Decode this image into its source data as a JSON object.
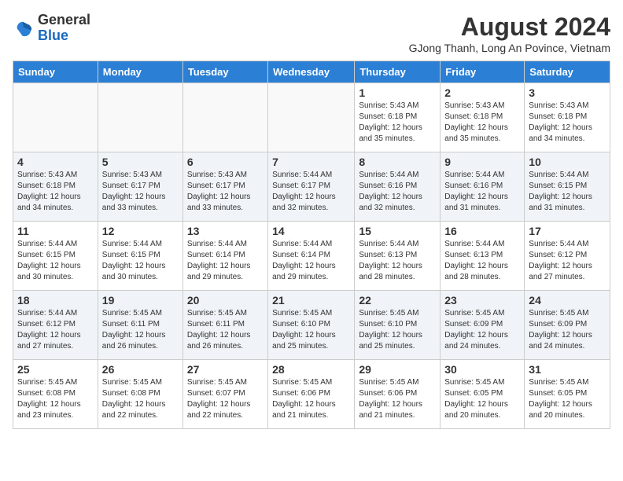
{
  "header": {
    "logo_general": "General",
    "logo_blue": "Blue",
    "month_year": "August 2024",
    "location": "GJong Thanh, Long An Povince, Vietnam"
  },
  "weekdays": [
    "Sunday",
    "Monday",
    "Tuesday",
    "Wednesday",
    "Thursday",
    "Friday",
    "Saturday"
  ],
  "weeks": [
    [
      {
        "day": "",
        "info": ""
      },
      {
        "day": "",
        "info": ""
      },
      {
        "day": "",
        "info": ""
      },
      {
        "day": "",
        "info": ""
      },
      {
        "day": "1",
        "info": "Sunrise: 5:43 AM\nSunset: 6:18 PM\nDaylight: 12 hours\nand 35 minutes."
      },
      {
        "day": "2",
        "info": "Sunrise: 5:43 AM\nSunset: 6:18 PM\nDaylight: 12 hours\nand 35 minutes."
      },
      {
        "day": "3",
        "info": "Sunrise: 5:43 AM\nSunset: 6:18 PM\nDaylight: 12 hours\nand 34 minutes."
      }
    ],
    [
      {
        "day": "4",
        "info": "Sunrise: 5:43 AM\nSunset: 6:18 PM\nDaylight: 12 hours\nand 34 minutes."
      },
      {
        "day": "5",
        "info": "Sunrise: 5:43 AM\nSunset: 6:17 PM\nDaylight: 12 hours\nand 33 minutes."
      },
      {
        "day": "6",
        "info": "Sunrise: 5:43 AM\nSunset: 6:17 PM\nDaylight: 12 hours\nand 33 minutes."
      },
      {
        "day": "7",
        "info": "Sunrise: 5:44 AM\nSunset: 6:17 PM\nDaylight: 12 hours\nand 32 minutes."
      },
      {
        "day": "8",
        "info": "Sunrise: 5:44 AM\nSunset: 6:16 PM\nDaylight: 12 hours\nand 32 minutes."
      },
      {
        "day": "9",
        "info": "Sunrise: 5:44 AM\nSunset: 6:16 PM\nDaylight: 12 hours\nand 31 minutes."
      },
      {
        "day": "10",
        "info": "Sunrise: 5:44 AM\nSunset: 6:15 PM\nDaylight: 12 hours\nand 31 minutes."
      }
    ],
    [
      {
        "day": "11",
        "info": "Sunrise: 5:44 AM\nSunset: 6:15 PM\nDaylight: 12 hours\nand 30 minutes."
      },
      {
        "day": "12",
        "info": "Sunrise: 5:44 AM\nSunset: 6:15 PM\nDaylight: 12 hours\nand 30 minutes."
      },
      {
        "day": "13",
        "info": "Sunrise: 5:44 AM\nSunset: 6:14 PM\nDaylight: 12 hours\nand 29 minutes."
      },
      {
        "day": "14",
        "info": "Sunrise: 5:44 AM\nSunset: 6:14 PM\nDaylight: 12 hours\nand 29 minutes."
      },
      {
        "day": "15",
        "info": "Sunrise: 5:44 AM\nSunset: 6:13 PM\nDaylight: 12 hours\nand 28 minutes."
      },
      {
        "day": "16",
        "info": "Sunrise: 5:44 AM\nSunset: 6:13 PM\nDaylight: 12 hours\nand 28 minutes."
      },
      {
        "day": "17",
        "info": "Sunrise: 5:44 AM\nSunset: 6:12 PM\nDaylight: 12 hours\nand 27 minutes."
      }
    ],
    [
      {
        "day": "18",
        "info": "Sunrise: 5:44 AM\nSunset: 6:12 PM\nDaylight: 12 hours\nand 27 minutes."
      },
      {
        "day": "19",
        "info": "Sunrise: 5:45 AM\nSunset: 6:11 PM\nDaylight: 12 hours\nand 26 minutes."
      },
      {
        "day": "20",
        "info": "Sunrise: 5:45 AM\nSunset: 6:11 PM\nDaylight: 12 hours\nand 26 minutes."
      },
      {
        "day": "21",
        "info": "Sunrise: 5:45 AM\nSunset: 6:10 PM\nDaylight: 12 hours\nand 25 minutes."
      },
      {
        "day": "22",
        "info": "Sunrise: 5:45 AM\nSunset: 6:10 PM\nDaylight: 12 hours\nand 25 minutes."
      },
      {
        "day": "23",
        "info": "Sunrise: 5:45 AM\nSunset: 6:09 PM\nDaylight: 12 hours\nand 24 minutes."
      },
      {
        "day": "24",
        "info": "Sunrise: 5:45 AM\nSunset: 6:09 PM\nDaylight: 12 hours\nand 24 minutes."
      }
    ],
    [
      {
        "day": "25",
        "info": "Sunrise: 5:45 AM\nSunset: 6:08 PM\nDaylight: 12 hours\nand 23 minutes."
      },
      {
        "day": "26",
        "info": "Sunrise: 5:45 AM\nSunset: 6:08 PM\nDaylight: 12 hours\nand 22 minutes."
      },
      {
        "day": "27",
        "info": "Sunrise: 5:45 AM\nSunset: 6:07 PM\nDaylight: 12 hours\nand 22 minutes."
      },
      {
        "day": "28",
        "info": "Sunrise: 5:45 AM\nSunset: 6:06 PM\nDaylight: 12 hours\nand 21 minutes."
      },
      {
        "day": "29",
        "info": "Sunrise: 5:45 AM\nSunset: 6:06 PM\nDaylight: 12 hours\nand 21 minutes."
      },
      {
        "day": "30",
        "info": "Sunrise: 5:45 AM\nSunset: 6:05 PM\nDaylight: 12 hours\nand 20 minutes."
      },
      {
        "day": "31",
        "info": "Sunrise: 5:45 AM\nSunset: 6:05 PM\nDaylight: 12 hours\nand 20 minutes."
      }
    ]
  ]
}
